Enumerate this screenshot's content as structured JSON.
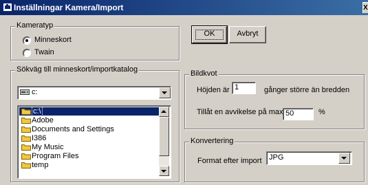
{
  "window": {
    "title": "Inställningar Kamera/Import",
    "close_glyph": "X"
  },
  "kameratyp": {
    "label": "Kameratyp",
    "options": [
      {
        "label": "Minneskort",
        "checked": true
      },
      {
        "label": "Twain",
        "checked": false
      }
    ]
  },
  "buttons": {
    "ok": "OK",
    "cancel": "Avbryt"
  },
  "path": {
    "label": "Sökväg till minneskort/importkatalog",
    "drive_value": "c:",
    "folders": [
      {
        "name": "c:\\",
        "selected": true
      },
      {
        "name": "Adobe",
        "selected": false
      },
      {
        "name": "Documents and Settings",
        "selected": false
      },
      {
        "name": "I386",
        "selected": false
      },
      {
        "name": "My Music",
        "selected": false
      },
      {
        "name": "Program Files",
        "selected": false
      },
      {
        "name": "temp",
        "selected": false
      }
    ]
  },
  "bildkvot": {
    "label": "Bildkvot",
    "height_prefix": "Höjden är",
    "height_value": "1",
    "height_suffix": "gånger större än bredden",
    "tolerance_label": "Tillåt en avvikelse på max",
    "tolerance_value": "50",
    "tolerance_unit": "%"
  },
  "konvertering": {
    "label": "Konvertering",
    "format_label": "Format efter import",
    "format_value": "JPG"
  },
  "colors": {
    "title_start": "#0a246a",
    "title_end": "#3a6ea5",
    "face": "#d4d0c8",
    "selection": "#0a246a"
  }
}
